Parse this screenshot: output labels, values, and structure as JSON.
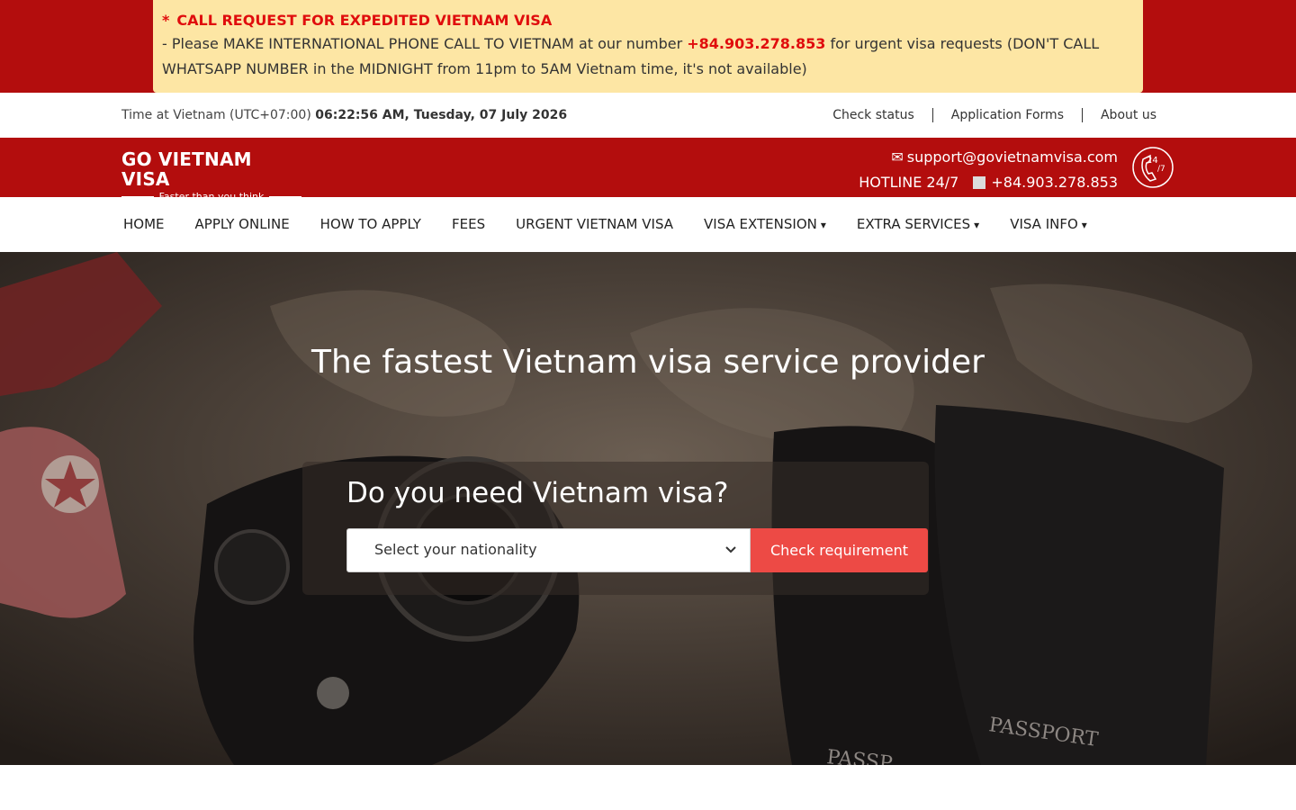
{
  "alert": {
    "star": "*",
    "title": "CALL REQUEST FOR EXPEDITED VIETNAM VISA",
    "body_before": "- Please MAKE INTERNATIONAL PHONE CALL TO VIETNAM at our number",
    "phone": "+84.903.278.853",
    "body_after": "for urgent visa requests (DON'T CALL WHATSAPP NUMBER in the MIDNIGHT from 11pm to 5AM Vietnam time, it's not available)"
  },
  "utility": {
    "time_label": "Time at Vietnam (UTC+07:00)",
    "time_value": "06:22:56 AM, Tuesday, 07 July 2026",
    "links": [
      "Check status",
      "Application Forms",
      "About us"
    ]
  },
  "brand": {
    "logo_main": "GO VIETNAM VISA",
    "logo_sub": "Faster than you think",
    "email_icon": "envelope-icon",
    "email": "support@govietnamvisa.com",
    "hotline_label": "HOTLINE 24/7",
    "hotline_number": "+84.903.278.853",
    "badge_text": "24/7"
  },
  "nav": {
    "items": [
      "HOME",
      "APPLY ONLINE",
      "HOW TO APPLY",
      "FEES",
      "URGENT VIETNAM VISA",
      "VISA EXTENSION",
      "EXTRA SERVICES",
      "VISA INFO"
    ],
    "caret_icon": "chevron-down-icon"
  },
  "hero": {
    "title": "The fastest Vietnam visa service provider",
    "question": "Do you need Vietnam visa?",
    "select_placeholder": "Select your nationality",
    "button_label": "Check requirement"
  },
  "colors": {
    "brand_red": "#b30d0d",
    "alert_bg": "#fde6a4",
    "alert_red": "#e00d0d",
    "button": "#ed4a45"
  }
}
